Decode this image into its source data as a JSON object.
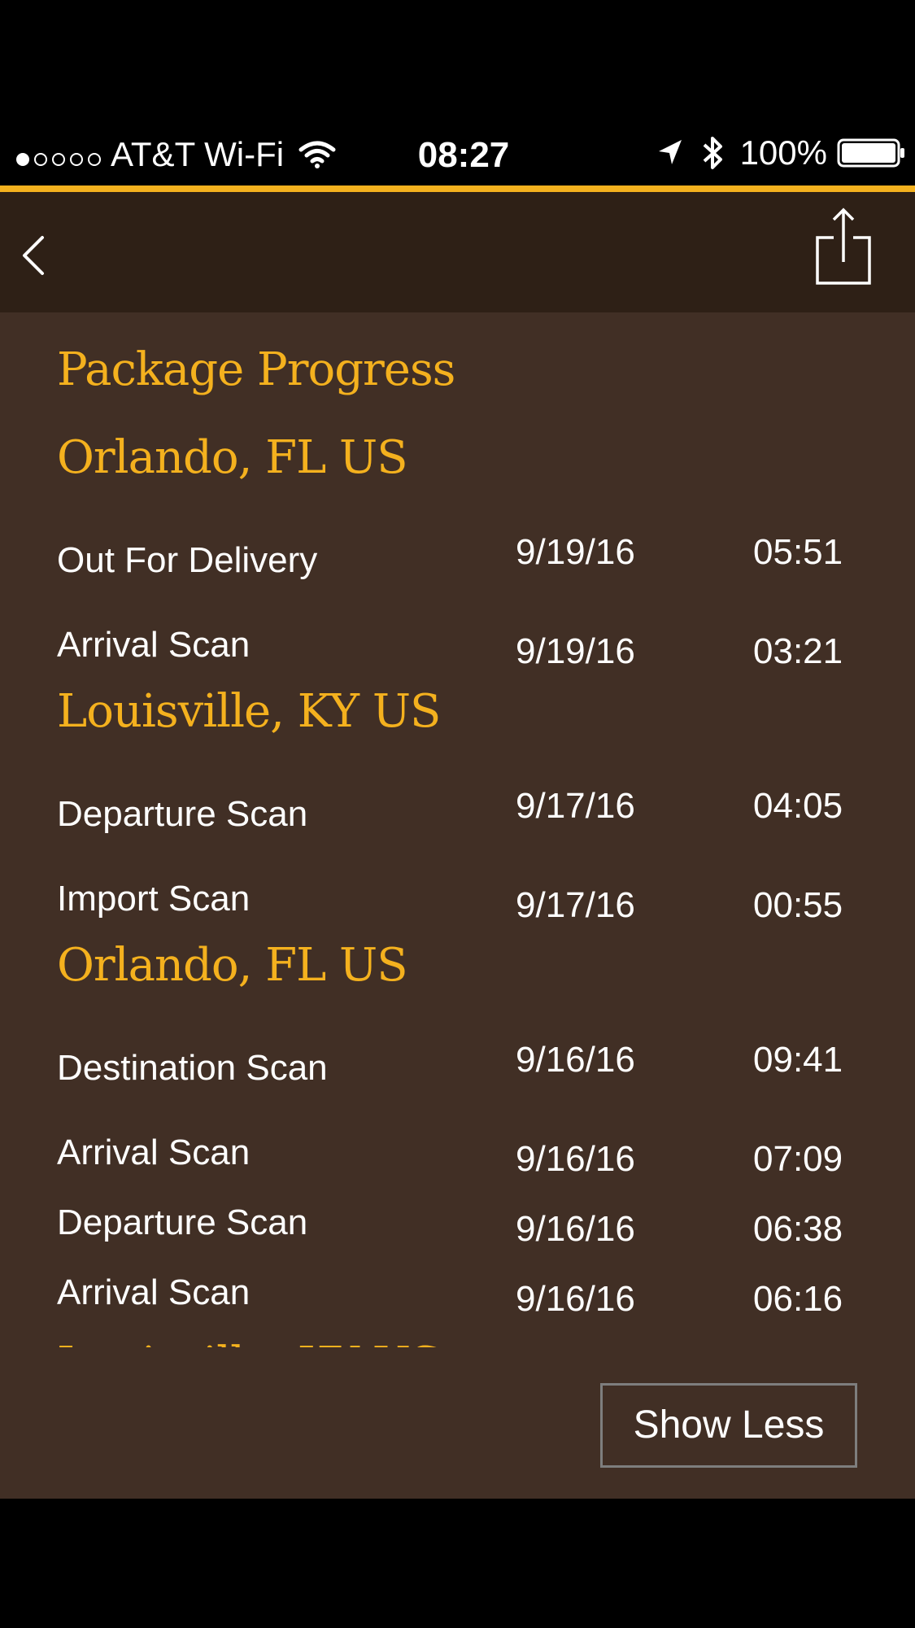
{
  "status_bar": {
    "carrier": "AT&T Wi-Fi",
    "time": "08:27",
    "battery": "100%",
    "signal_filled": 1,
    "signal_total": 5
  },
  "nav": {
    "back_icon": "chevron-left-icon",
    "share_icon": "share-icon"
  },
  "colors": {
    "accent": "#f4b11e",
    "nav_bg": "#2e2016",
    "content_bg": "#412f25"
  },
  "page_title": "Package Progress",
  "locations": [
    {
      "name": "Orlando, FL US",
      "events": [
        {
          "description": "Out For Delivery",
          "date": "9/19/16",
          "time": "05:51"
        },
        {
          "description": "Arrival Scan",
          "date": "9/19/16",
          "time": "03:21"
        }
      ]
    },
    {
      "name": "Louisville, KY US",
      "events": [
        {
          "description": "Departure Scan",
          "date": "9/17/16",
          "time": "04:05"
        },
        {
          "description": "Import Scan",
          "date": "9/17/16",
          "time": "00:55"
        }
      ]
    },
    {
      "name": "Orlando, FL US",
      "events": [
        {
          "description": "Destination Scan",
          "date": "9/16/16",
          "time": "09:41"
        },
        {
          "description": "Arrival Scan",
          "date": "9/16/16",
          "time": "07:09"
        },
        {
          "description": "Departure Scan",
          "date": "9/16/16",
          "time": "06:38"
        },
        {
          "description": "Arrival Scan",
          "date": "9/16/16",
          "time": "06:16"
        }
      ]
    },
    {
      "name": "Louisville, KY US",
      "events": []
    }
  ],
  "show_less_label": "Show Less"
}
